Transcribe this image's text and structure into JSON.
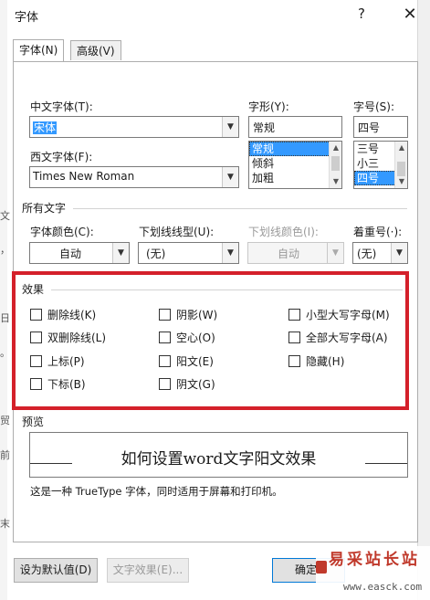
{
  "window": {
    "title": "字体",
    "help": "?",
    "close": "✕"
  },
  "tabs": [
    {
      "label": "字体(N)",
      "active": true
    },
    {
      "label": "高级(V)",
      "active": false
    }
  ],
  "fields": {
    "chinese_font_label": "中文字体(T):",
    "chinese_font_value": "宋体",
    "western_font_label": "西文字体(F):",
    "western_font_value": "Times New Roman",
    "style_label": "字形(Y):",
    "style_value": "常规",
    "style_options": [
      "常规",
      "倾斜",
      "加粗"
    ],
    "size_label": "字号(S):",
    "size_value": "四号",
    "size_options": [
      "三号",
      "小三",
      "四号"
    ]
  },
  "all_text": {
    "section_label": "所有文字",
    "font_color_label": "字体颜色(C):",
    "font_color_value": "自动",
    "underline_style_label": "下划线线型(U):",
    "underline_style_value": "(无)",
    "underline_color_label": "下划线颜色(I):",
    "underline_color_value": "自动",
    "emphasis_label": "着重号(·):",
    "emphasis_value": "(无)"
  },
  "effects": {
    "section_label": "效果",
    "checkboxes": [
      {
        "label": "删除线(K)",
        "checked": false
      },
      {
        "label": "阴影(W)",
        "checked": false
      },
      {
        "label": "小型大写字母(M)",
        "checked": false
      },
      {
        "label": "双删除线(L)",
        "checked": false
      },
      {
        "label": "空心(O)",
        "checked": false
      },
      {
        "label": "全部大写字母(A)",
        "checked": false
      },
      {
        "label": "上标(P)",
        "checked": false
      },
      {
        "label": "阳文(E)",
        "checked": false
      },
      {
        "label": "隐藏(H)",
        "checked": false
      },
      {
        "label": "下标(B)",
        "checked": false
      },
      {
        "label": "阴文(G)",
        "checked": false
      }
    ]
  },
  "preview": {
    "section_label": "预览",
    "sample_text": "如何设置word文字阳文效果",
    "note": "这是一种 TrueType 字体，同时适用于屏幕和打印机。"
  },
  "buttons": {
    "set_default": "设为默认值(D)",
    "text_effects": "文字效果(E)...",
    "ok": "确定"
  },
  "watermark": {
    "logo": "易采站长站",
    "url": "www.easck.com"
  },
  "background_fragments": [
    "文",
    "，",
    "日",
    "。",
    "贸",
    "前",
    "末"
  ],
  "colors": {
    "highlight": "#3399ff",
    "annotation_frame": "#d4202a",
    "dialog_bg": "#ffffff"
  }
}
